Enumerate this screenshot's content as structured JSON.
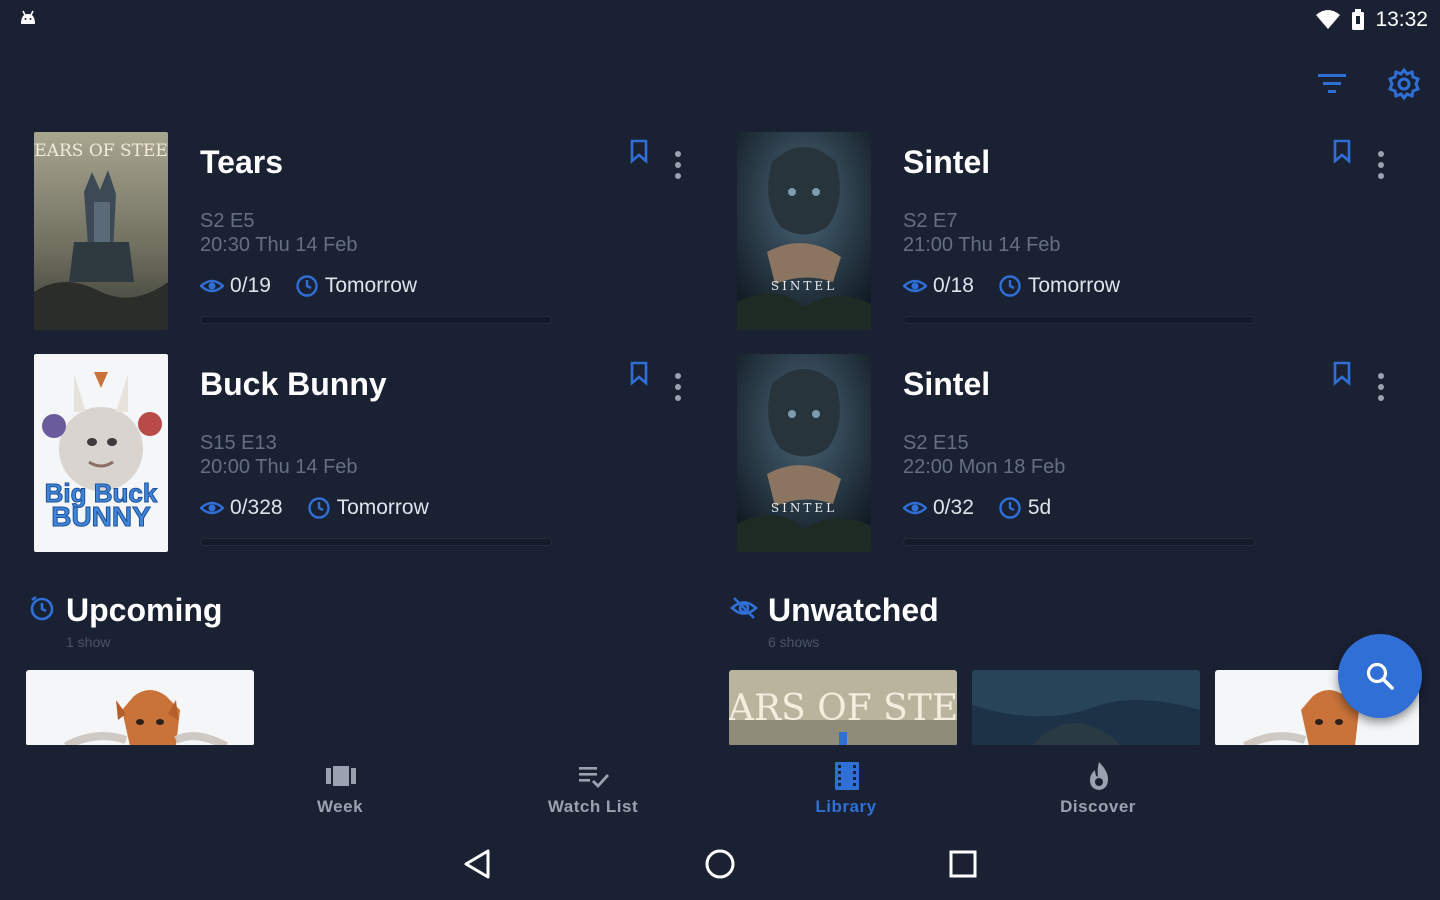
{
  "status_bar": {
    "time": "13:32"
  },
  "toolbar": {
    "filter_icon": "filter-icon",
    "settings_icon": "settings-icon"
  },
  "colors": {
    "accent": "#2f6fd6",
    "background": "#1a2133",
    "muted_text": "#666f80"
  },
  "cards": [
    {
      "title": "Tears",
      "episode": "S2 E5",
      "air_time": "20:30 Thu 14 Feb",
      "watched": "0/19",
      "next": "Tomorrow",
      "progress": 0,
      "poster": "Tears of Steel"
    },
    {
      "title": "Sintel",
      "episode": "S2 E7",
      "air_time": "21:00 Thu 14 Feb",
      "watched": "0/18",
      "next": "Tomorrow",
      "progress": 0,
      "poster": "Sintel"
    },
    {
      "title": "Buck Bunny",
      "episode": "S15 E13",
      "air_time": "20:00 Thu 14 Feb",
      "watched": "0/328",
      "next": "Tomorrow",
      "progress": 0,
      "poster": "Big Buck Bunny"
    },
    {
      "title": "Sintel",
      "episode": "S2 E15",
      "air_time": "22:00 Mon 18 Feb",
      "watched": "0/32",
      "next": "5d",
      "progress": 0,
      "poster": "Sintel"
    }
  ],
  "sections": {
    "upcoming": {
      "title": "Upcoming",
      "subtitle": "1 show"
    },
    "unwatched": {
      "title": "Unwatched",
      "subtitle": "6 shows"
    }
  },
  "posters": {
    "tears_logo": "TEARS OF STEEL",
    "sintel_logo": "SINTEL",
    "bunny_logo_1": "Big Buck",
    "bunny_logo_2": "BUNNY"
  },
  "fab": {
    "icon": "search-icon"
  },
  "bottom_nav": [
    {
      "label": "Week",
      "icon": "week-icon",
      "active": false
    },
    {
      "label": "Watch List",
      "icon": "watch-list-icon",
      "active": false
    },
    {
      "label": "Library",
      "icon": "library-icon",
      "active": true
    },
    {
      "label": "Discover",
      "icon": "fire-icon",
      "active": false
    }
  ]
}
